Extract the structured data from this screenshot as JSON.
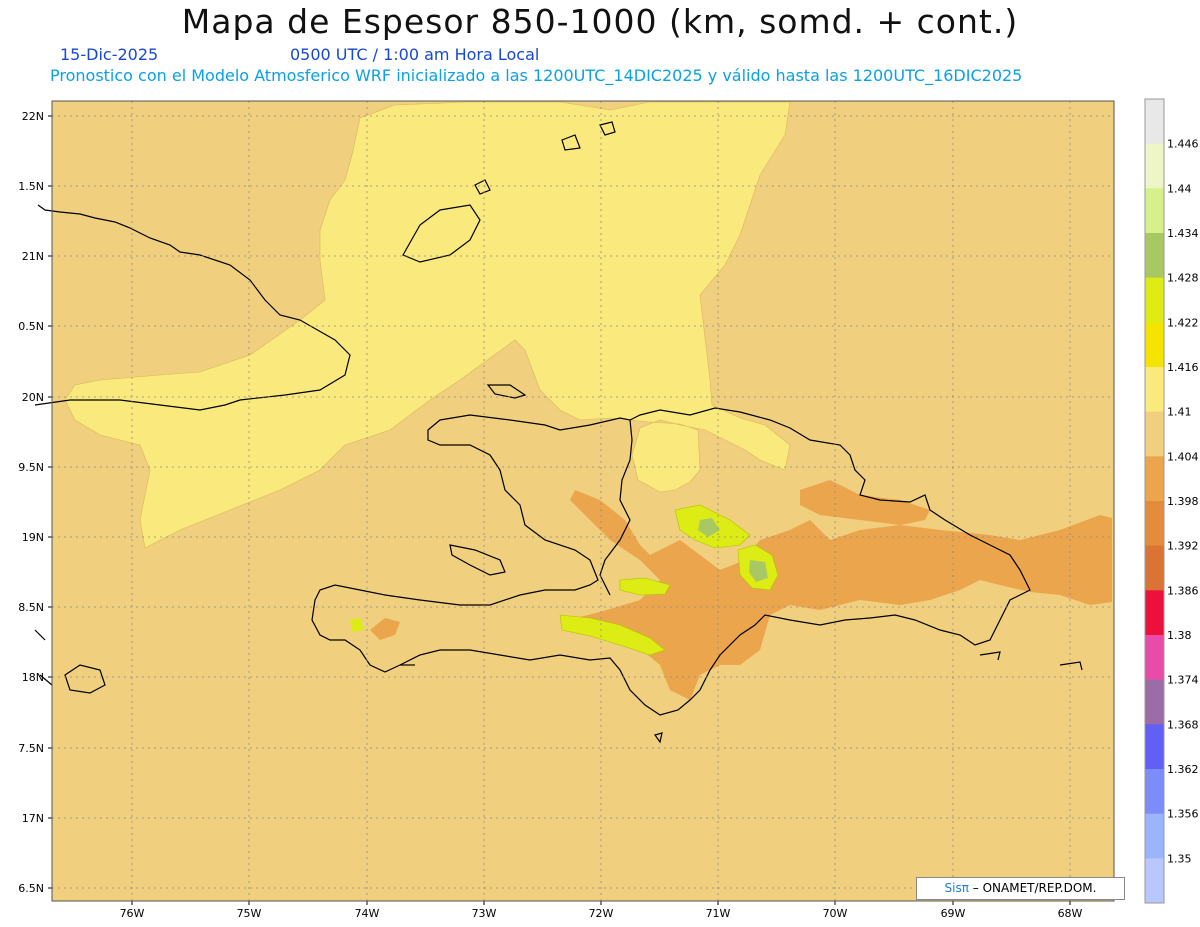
{
  "header": {
    "title": "Mapa de Espesor 850-1000 (km, somd. + cont.)",
    "date": "15-Dic-2025",
    "time": "0500 UTC / 1:00 am Hora Local",
    "description": "Pronostico con el Modelo Atmosferico WRF inicializado a las 1200UTC_14DIC2025 y válido hasta las  1200UTC_16DIC2025"
  },
  "axes": {
    "lat_labels": [
      "22N",
      "1.5N",
      "21N",
      "0.5N",
      "20N",
      "9.5N",
      "19N",
      "8.5N",
      "18N",
      "7.5N",
      "17N",
      "6.5N"
    ],
    "lon_labels": [
      "76W",
      "75W",
      "74W",
      "73W",
      "72W",
      "71W",
      "70W",
      "69W",
      "68W"
    ]
  },
  "colorbar": {
    "labels": [
      "1.446",
      "1.44",
      "1.434",
      "1.428",
      "1.422",
      "1.416",
      "1.41",
      "1.404",
      "1.398",
      "1.392",
      "1.386",
      "1.38",
      "1.374",
      "1.368",
      "1.362",
      "1.356",
      "1.35"
    ],
    "colors": [
      "#e8e8e8",
      "#eef6c8",
      "#d8f08c",
      "#a8c864",
      "#dcec14",
      "#f4e400",
      "#fae97c",
      "#f0cf7e",
      "#eba54c",
      "#e28c3c",
      "#da7434",
      "#ec103c",
      "#e84ca8",
      "#9c6ca8",
      "#6060f4",
      "#7c8cf8",
      "#9cb4fc",
      "#b8c8fc"
    ]
  },
  "credit": {
    "brand": "Sisπ",
    "text": " – ONAMET/REP.DOM."
  },
  "colors": {
    "background_field": "#f0cf7e",
    "light_field": "#fae97c",
    "warm_field": "#eba54c",
    "coastline": "#000000",
    "grid": "#8a8a8a"
  }
}
